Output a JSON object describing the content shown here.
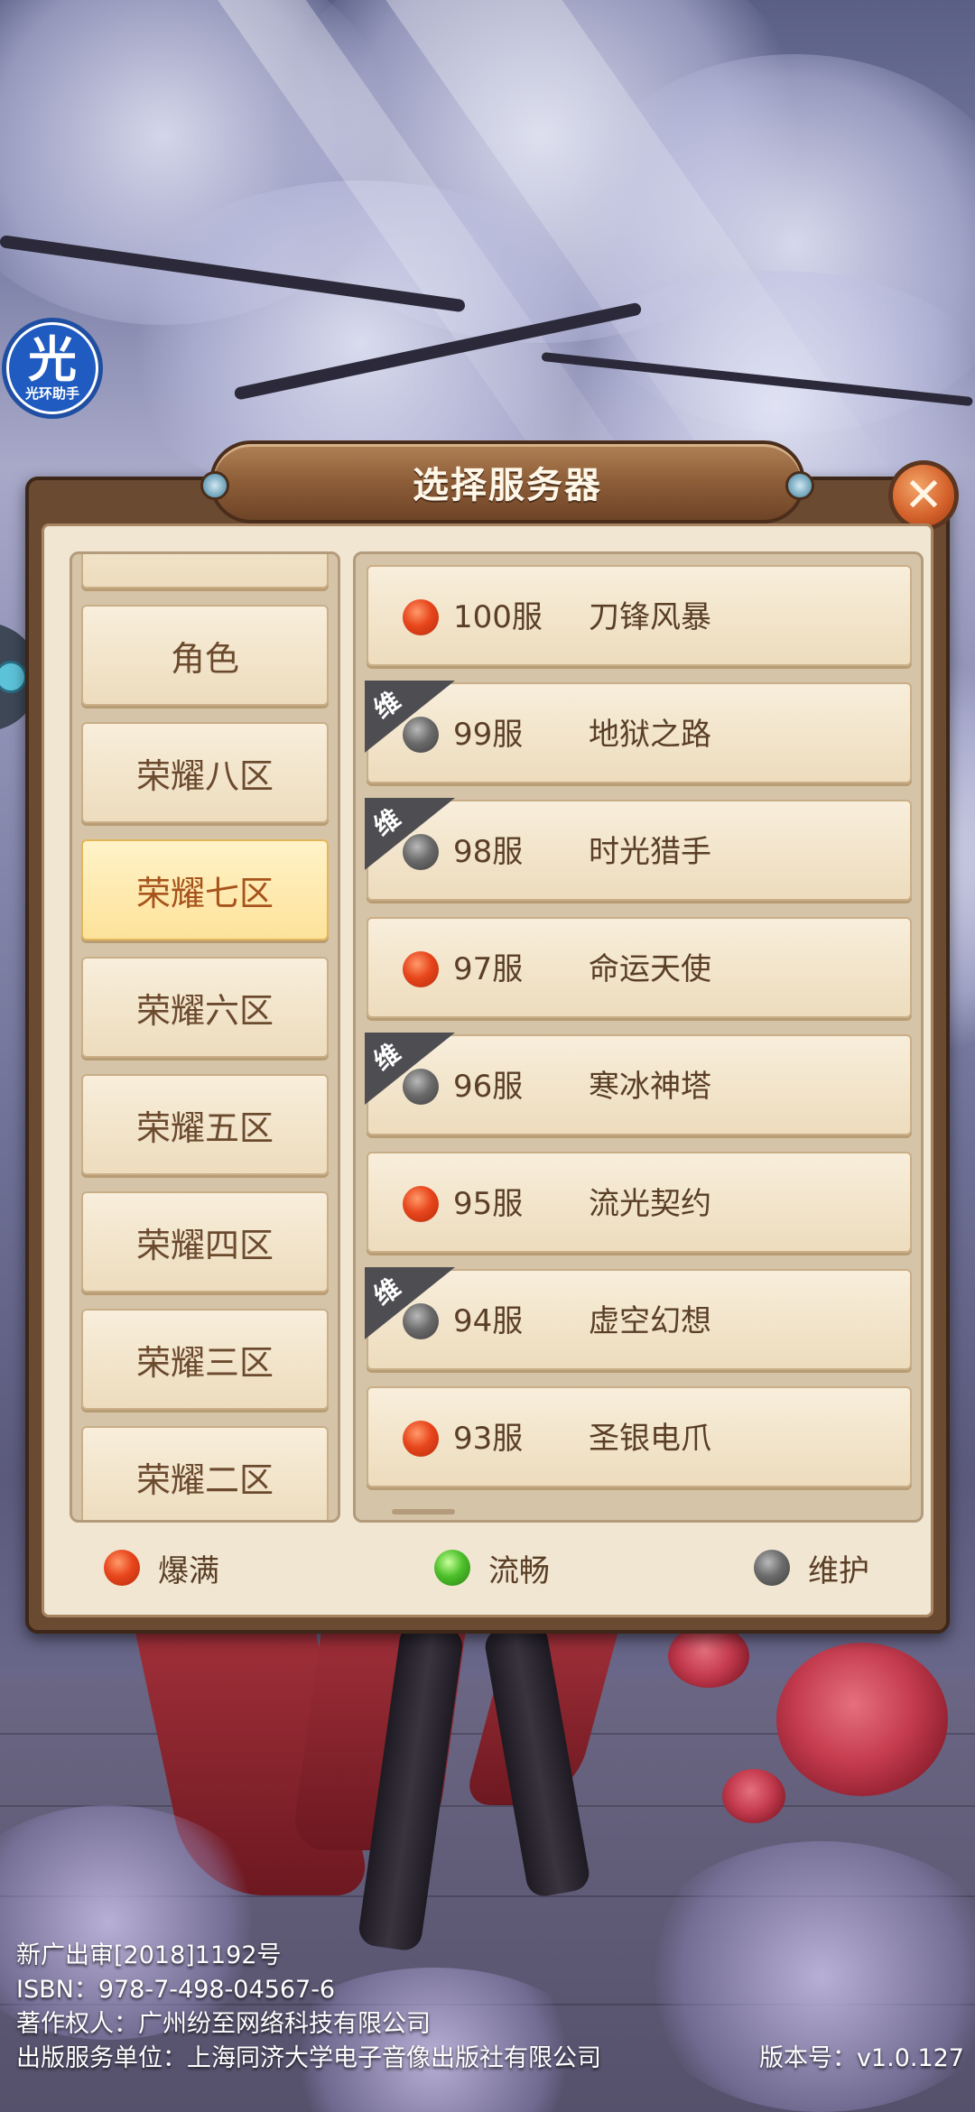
{
  "helper": {
    "glyph": "光",
    "label": "光环助手"
  },
  "dialog": {
    "title": "选择服务器",
    "close_icon": "✕"
  },
  "zones": [
    "",
    "角色",
    "荣耀八区",
    "荣耀七区",
    "荣耀六区",
    "荣耀五区",
    "荣耀四区",
    "荣耀三区",
    "荣耀二区"
  ],
  "selected_zone": "荣耀七区",
  "servers": [
    {
      "num": "100服",
      "name": "刀锋风暴",
      "status": "full",
      "maintenance": false
    },
    {
      "num": "99服",
      "name": "地狱之路",
      "status": "maint",
      "maintenance": true,
      "tag": "维"
    },
    {
      "num": "98服",
      "name": "时光猎手",
      "status": "maint",
      "maintenance": true,
      "tag": "维"
    },
    {
      "num": "97服",
      "name": "命运天使",
      "status": "full",
      "maintenance": false
    },
    {
      "num": "96服",
      "name": "寒冰神塔",
      "status": "maint",
      "maintenance": true,
      "tag": "维"
    },
    {
      "num": "95服",
      "name": "流光契约",
      "status": "full",
      "maintenance": false
    },
    {
      "num": "94服",
      "name": "虚空幻想",
      "status": "maint",
      "maintenance": true,
      "tag": "维"
    },
    {
      "num": "93服",
      "name": "圣银电爪",
      "status": "full",
      "maintenance": false
    }
  ],
  "legend": [
    {
      "label": "爆满",
      "status": "full"
    },
    {
      "label": "流畅",
      "status": "smooth"
    },
    {
      "label": "维护",
      "status": "maint"
    }
  ],
  "footer": {
    "line1": "新广出审[2018]1192号",
    "line2": "ISBN：978-7-498-04567-6",
    "line3": "著作权人：广州纷至网络科技有限公司",
    "line4": "出版服务单位：上海同济大学电子音像出版社有限公司",
    "version": "版本号：v1.0.127"
  },
  "colors": {
    "panel_frame": "#6b4a32",
    "panel_bg": "#f1e6d2",
    "selected_zone_text": "#a7531c",
    "text_brown": "#5a3e26"
  }
}
